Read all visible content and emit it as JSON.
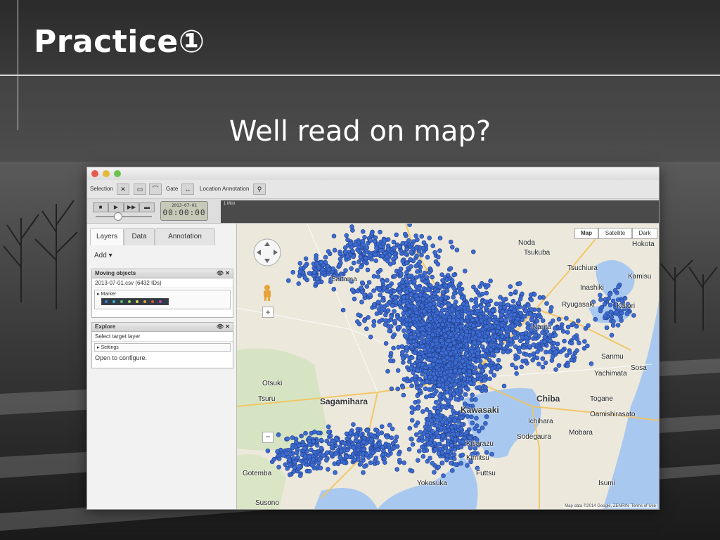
{
  "slide": {
    "title": "Practice①",
    "subtitle": "Well read on map?"
  },
  "colors": {
    "window_bg": "#ececec",
    "points": "#3d6bd1",
    "water": "#a8c8ef",
    "land": "#e9e5d9"
  },
  "toolbar": {
    "selection_label": "Selection",
    "gate_label": "Gate",
    "location_annotation_label": "Location Annotation"
  },
  "timebar": {
    "date": "2013-07-01",
    "time": "00:00:00",
    "menu_label": "1 Mini"
  },
  "panel": {
    "tabs": [
      "Layers",
      "Data",
      "Annotation"
    ],
    "add_label": "Add ▾",
    "moving_objects": {
      "header": "Moving objects",
      "file_row": "2013-07-01.csv (6432 IDs)",
      "marker_label": "▸ Marker"
    },
    "explore": {
      "header": "Explore",
      "select_label": "Select target layer",
      "settings_label": "▸ Settings",
      "open_label": "Open to configure."
    }
  },
  "map": {
    "buttons": [
      "Map",
      "Satellite",
      "Dark"
    ],
    "attribution": "Map data ©2014 Google, ZENRIN",
    "terms": "Terms of Use",
    "labels": {
      "tsukuba": "Tsukuba",
      "tsuchiura": "Tsuchiura",
      "hokota": "Hokota",
      "kamisu": "Kamisu",
      "inashiki": "Inashiki",
      "ryugasaki": "Ryugasaki",
      "katori": "Katori",
      "sosa": "Sosa",
      "sanmu": "Sanmu",
      "yachimata": "Yachimata",
      "togane": "Togane",
      "oamishirasato": "Oamishirasato",
      "mobara": "Mobara",
      "isumi": "Isumi",
      "chiba": "Chiba",
      "ichihara": "Ichihara",
      "sodegaura": "Sodegaura",
      "kisarazu": "Kisarazu",
      "kimitsu": "Kimitsu",
      "futtsu": "Futtsu",
      "kawasaki": "Kawasaki",
      "yokosuka": "Yokosuka",
      "sagamihara": "Sagamihara",
      "saitama": "Saitama",
      "tsuru": "Tsuru",
      "otsuki": "Otsuki",
      "gotemba": "Gotemba",
      "susono": "Susono",
      "narita": "Narita",
      "noda": "Noda"
    }
  }
}
